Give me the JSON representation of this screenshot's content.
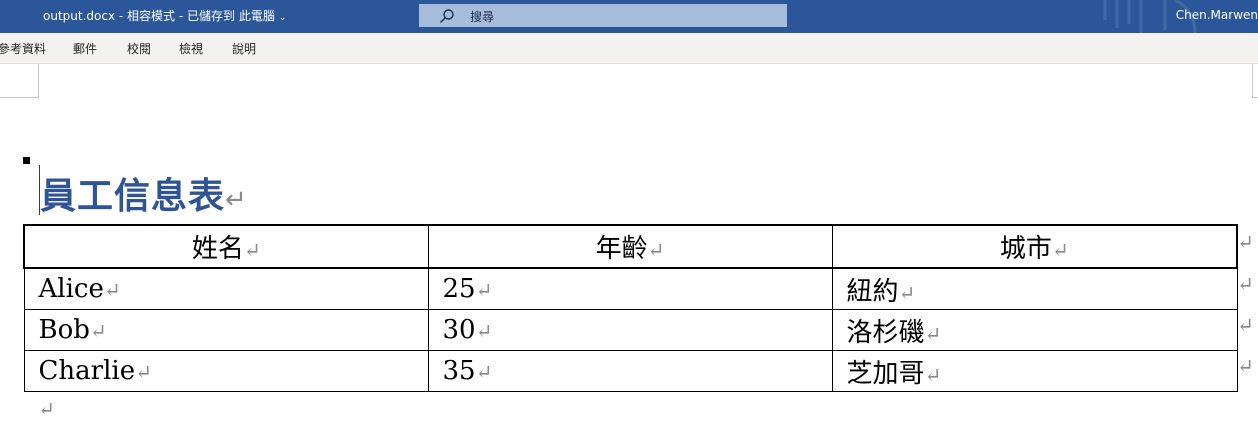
{
  "titlebar": {
    "filename": "output.docx",
    "separator1": " - ",
    "mode": "相容模式",
    "separator2": " - ",
    "save_status": "已儲存到 此電腦",
    "save_caret": "⌄",
    "search_placeholder": "搜尋",
    "user_name": "Chen.Marwen"
  },
  "ribbon": {
    "tabs": [
      "參考資料",
      "郵件",
      "校閱",
      "檢視",
      "說明"
    ]
  },
  "document": {
    "heading": "員工信息表",
    "paragraph_mark": "↵",
    "cell_mark": "↵",
    "table": {
      "headers": [
        "姓名",
        "年齡",
        "城市"
      ],
      "rows": [
        [
          "Alice",
          "25",
          "紐約"
        ],
        [
          "Bob",
          "30",
          "洛杉磯"
        ],
        [
          "Charlie",
          "35",
          "芝加哥"
        ]
      ]
    }
  },
  "colors": {
    "title_bar": "#2b579a",
    "heading": "#2f5496",
    "search_box": "#a7bcd9"
  }
}
